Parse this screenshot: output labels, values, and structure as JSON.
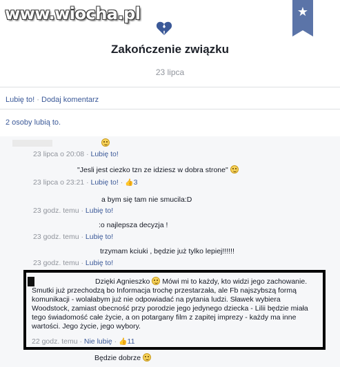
{
  "watermark": "www.wiocha.pl",
  "event": {
    "title": "Zakończenie związku",
    "date": "23 lipca"
  },
  "actions": {
    "like": "Lubię to!",
    "separator": "·",
    "comment": "Dodaj komentarz"
  },
  "likes_summary": "2 osoby lubią to.",
  "comments": [
    {
      "text": "",
      "time": "23 lipca o 20:08",
      "like_label": "Lubię to!",
      "likes": ""
    },
    {
      "text": "\"Jesli jest ciezko tzn ze idziesz w dobra strone\"",
      "time": "23 lipca o 23:21",
      "like_label": "Lubię to!",
      "likes": "3"
    },
    {
      "text": "a bym się tam nie smucila:D",
      "time": "23 godz. temu",
      "like_label": "Lubię to!",
      "likes": ""
    },
    {
      "text": ":o najlepsza decyzja !",
      "time": "23 godz. temu",
      "like_label": "Lubię to!",
      "likes": ""
    },
    {
      "text": "trzymam kciuki , będzie już tylko lepiej!!!!!!",
      "time": "23 godz. temu",
      "like_label": "Lubię to!",
      "likes": ""
    },
    {
      "text_start": "Dzięki Agnieszko",
      "text_rest": "Mówi mi to każdy, kto widzi jego zachowanie. Smutki już przechodzą bo Informacja trochę przestarzała, ale Fb najszybszą formą komunikacji - wolałabym już nie odpowiadać na pytania ludzi. Sławek wybiera Woodstock, zamiast obecność przy porodzie jego jedynego dziecka - Lilii będzie miała tego świadomość całe życie, a on potargany film z zapitej imprezy - każdy ma inne wartości. Jego życie, jego wybory.",
      "time": "22 godz. temu",
      "like_label": "Nie lubię",
      "likes": "11"
    },
    {
      "text": "Będzie dobrze",
      "time": "",
      "like_label": "",
      "likes": ""
    }
  ],
  "icons": {
    "broken_heart": "broken-heart-icon",
    "star_flag": "star-icon",
    "thumbs_up": "thumbs-up-icon",
    "smiley": "smiley-icon"
  },
  "colors": {
    "link": "#3b5998",
    "muted": "#90949c",
    "heart": "#3b5998",
    "highlight_border": "#000000"
  }
}
